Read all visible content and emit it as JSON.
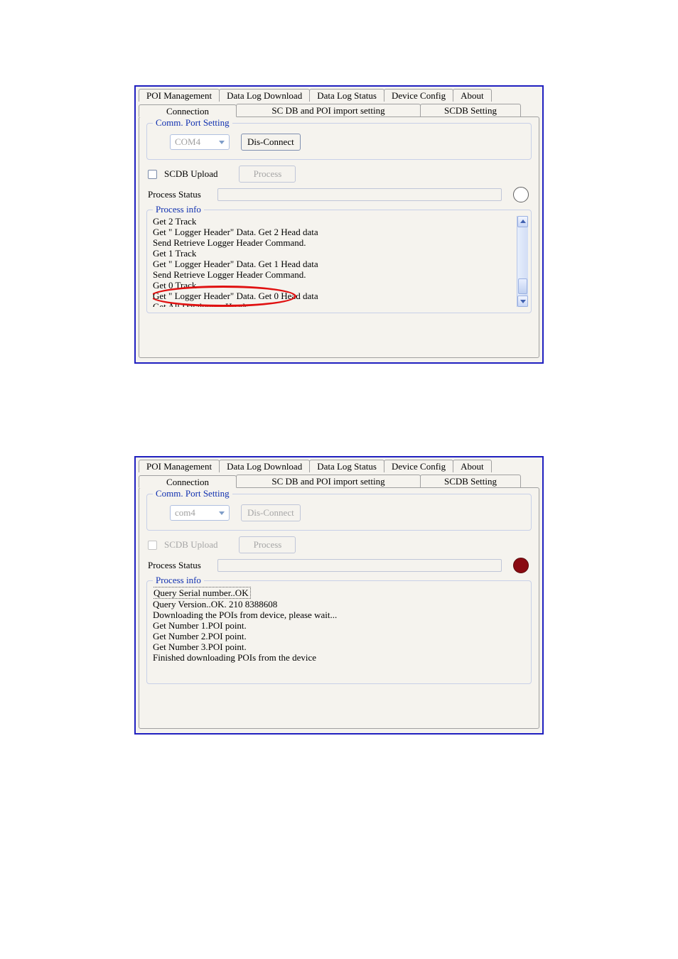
{
  "tabs_row1": {
    "poi_mgmt": "POI Management",
    "dl_download": "Data Log Download",
    "dl_status": "Data Log Status",
    "device_config": "Device Config",
    "about": "About"
  },
  "tabs_row2": {
    "connection": "Connection",
    "scdb_import": "SC DB and POI import setting",
    "scdb_setting": "SCDB  Setting"
  },
  "comm": {
    "legend": "Comm. Port Setting",
    "port_value_upper": "COM4",
    "port_value_lower": "com4",
    "disconnect": "Dis-Connect"
  },
  "scdb": {
    "checkbox_label": "SCDB Upload",
    "process_btn": "Process"
  },
  "status": {
    "label": "Process Status"
  },
  "info": {
    "legend": "Process info"
  },
  "panel1_log": {
    "l0": "Get 2 Track",
    "l1": "Get \" Logger Header\" Data. Get 2 Head data",
    "l2": "Send Retrieve Logger Header Command.",
    "l3": "Get 1 Track",
    "l4": "Get \" Logger Header\" Data. Get 1 Head data",
    "l5": "Send Retrieve Logger Header Command.",
    "l6": "Get 0 Track",
    "l7": "Get \" Logger Header\" Data. Get 0 Head data",
    "l8": "Get All Datalogger Heads"
  },
  "panel2_log": {
    "l0": "Query Serial number..OK",
    "l1": "Query Version..OK.  210       8388608",
    "l2": "Downloading the POIs from device, please wait...",
    "l3": "Get Number 1.POI point.",
    "l4": "Get Number 2.POI point.",
    "l5": "Get Number 3.POI point.",
    "l6": "Finished downloading POIs from the device"
  }
}
